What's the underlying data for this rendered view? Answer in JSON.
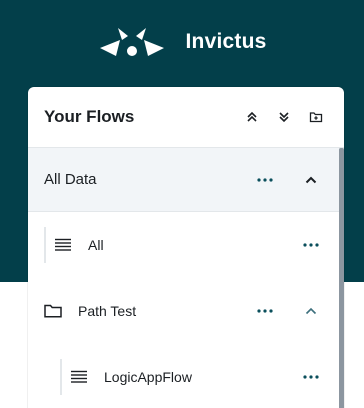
{
  "brand": {
    "name": "Invictus",
    "logo_icon": "invictus-logo-icon"
  },
  "panel": {
    "title": "Your Flows",
    "actions": [
      {
        "name": "collapse-all-icon"
      },
      {
        "name": "expand-all-icon"
      },
      {
        "name": "add-folder-icon"
      }
    ]
  },
  "tree": {
    "root": {
      "label": "All Data",
      "expanded": true
    },
    "items": [
      {
        "label": "All",
        "type": "flow"
      },
      {
        "label": "Path Test",
        "type": "folder",
        "expanded": true
      },
      {
        "label": "LogicAppFlow",
        "type": "flow"
      }
    ]
  },
  "colors": {
    "header_bg": "#033f4a",
    "accent": "#0b4f5c",
    "text": "#1b1f23"
  }
}
